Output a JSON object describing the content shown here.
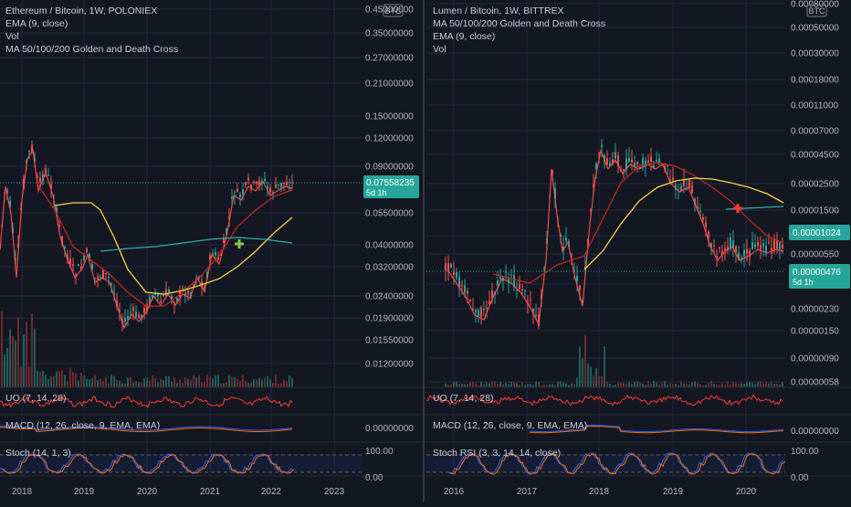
{
  "colors": {
    "bg": "#131722",
    "grid": "#2a2640",
    "text": "#b2b5be",
    "up": "#26a69a",
    "down": "#ef5350",
    "ema": "#ff5252",
    "ma_yellow": "#f5d442",
    "ma_teal": "#2bb3a8",
    "ma_red": "#c62828",
    "price_tag": "#26a69a",
    "uo": "#ff3b30",
    "macd": "#2962ff",
    "signal": "#ff6d00",
    "stoch_k": "#2962ff",
    "stoch_d": "#ff6d00",
    "cross_green": "#8bc34a",
    "cross_red": "#ff3b30"
  },
  "panels": [
    {
      "id": "eth",
      "legend": [
        "Ethereum / Bitcoin, 1W, POLONIEX",
        "EMA (9, close)",
        "Vol",
        "MA 50/100/200 Golden and Death Cross"
      ],
      "currency_icon": "BTC",
      "scale_labels": [
        "0.45000000",
        "0.35000000",
        "0.27000000",
        "0.21000000",
        "0.15000000",
        "0.12000000",
        "0.09000000",
        "0.05500000",
        "0.04000000",
        "0.03200000",
        "0.02400000",
        "0.01900000",
        "0.01550000",
        "0.01200000"
      ],
      "price_tag": {
        "value": "0.07558235",
        "countdown": "5d 1h"
      },
      "x_labels": [
        "2018",
        "2019",
        "2020",
        "2021",
        "2022",
        "2023"
      ],
      "cross_marker": "golden-cross",
      "indicators": {
        "uo": "UO (7, 14, 28)",
        "macd": "MACD (12, 26, close, 9, EMA, EMA)",
        "stoch": "Stoch (14, 1, 3)",
        "macd_value": "0.00000000",
        "stoch_top": "100.00",
        "stoch_bottom": "0.00"
      }
    },
    {
      "id": "xlm",
      "legend": [
        "Lumen / Bitcoin, 1W, BITTREX",
        "MA 50/100/200 Golden and Death Cross",
        "EMA (9, close)",
        "Vol"
      ],
      "currency_icon": "BTC",
      "scale_labels": [
        "0.00080000",
        "0.00050000",
        "0.00030000",
        "0.00018000",
        "0.00011000",
        "0.00007000",
        "0.00004500",
        "0.00002500",
        "0.00001500",
        "0.00000950",
        "0.00000550",
        "0.00000350",
        "0.00000230",
        "0.00000150",
        "0.00000090",
        "0.00000058"
      ],
      "price_tags": [
        {
          "value": "0.00001024",
          "countdown": ""
        },
        {
          "value": "0.00000476",
          "countdown": "5d 1h"
        }
      ],
      "x_labels": [
        "2016",
        "2017",
        "2018",
        "2019",
        "2020"
      ],
      "cross_marker": "death-cross",
      "indicators": {
        "uo": "UO (7, 14, 28)",
        "macd": "MACD (12, 26, close, 9, EMA, EMA)",
        "stoch": "Stoch RSI (3, 3, 14, 14, close)",
        "macd_value": "0.00000000",
        "stoch_top": "100.00",
        "stoch_bottom": "0.00"
      }
    }
  ]
}
